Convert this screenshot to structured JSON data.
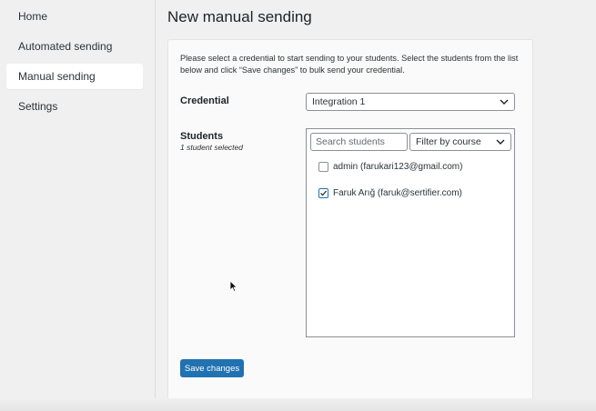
{
  "sidebar": {
    "items": [
      {
        "label": "Home"
      },
      {
        "label": "Automated sending"
      },
      {
        "label": "Manual sending",
        "active": true
      },
      {
        "label": "Settings"
      }
    ]
  },
  "page": {
    "title": "New manual sending",
    "intro": "Please select a credential to start sending to your students. Select the students from the list below and click “Save changes” to bulk send your credential."
  },
  "credential": {
    "label": "Credential",
    "selected": "Integration 1"
  },
  "students": {
    "label": "Students",
    "count_text": "1 student selected",
    "search_placeholder": "Search students",
    "filter_label": "Filter by course",
    "list": [
      {
        "label": "admin (farukari123@gmail.com)",
        "checked": false
      },
      {
        "label": "Faruk Arığ (faruk@sertifier.com)",
        "checked": true
      }
    ]
  },
  "actions": {
    "save_label": "Save changes"
  },
  "colors": {
    "primary": "#2271b1",
    "background": "#f0f0f1"
  }
}
